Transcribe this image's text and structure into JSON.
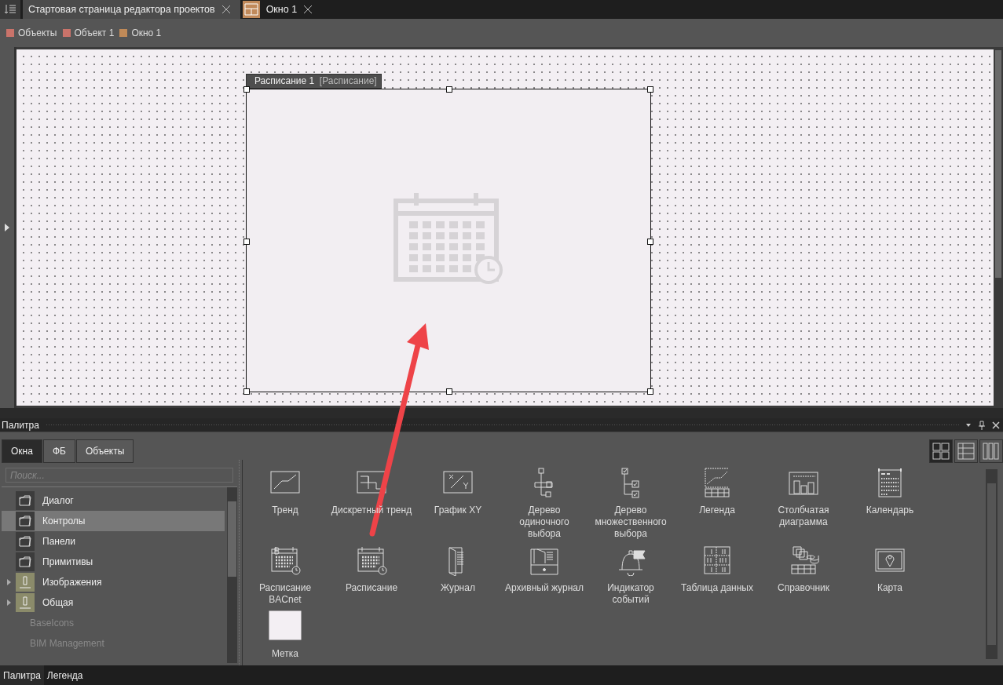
{
  "doc_tabs": [
    {
      "label": "Стартовая страница редактора проектов",
      "kind": "start",
      "selected": false
    },
    {
      "label": "Окно 1",
      "kind": "window",
      "selected": true
    }
  ],
  "breadcrumb": [
    {
      "label": "Объекты",
      "color": "#c9736a"
    },
    {
      "label": "Объект 1",
      "color": "#c9736a"
    },
    {
      "label": "Окно 1",
      "color": "#c08a58"
    }
  ],
  "canvas": {
    "widget": {
      "name": "Расписание 1",
      "type": "[Расписание]"
    }
  },
  "palette": {
    "title": "Палитра",
    "tabs": [
      {
        "label": "Окна",
        "selected": true
      },
      {
        "label": "ФБ",
        "selected": false
      },
      {
        "label": "Объекты",
        "selected": false
      }
    ],
    "search": {
      "placeholder": "Поиск..."
    },
    "tree": [
      {
        "label": "Диалог",
        "kind": "folder",
        "selected": false,
        "disabled": false
      },
      {
        "label": "Контролы",
        "kind": "folder",
        "selected": true,
        "disabled": false
      },
      {
        "label": "Панели",
        "kind": "folder",
        "selected": false,
        "disabled": false
      },
      {
        "label": "Примитивы",
        "kind": "folder",
        "selected": false,
        "disabled": false
      },
      {
        "label": "Изображения",
        "kind": "library",
        "selected": false,
        "disabled": false
      },
      {
        "label": "Общая",
        "kind": "library",
        "selected": false,
        "disabled": false
      },
      {
        "label": "BaseIcons",
        "kind": "text",
        "selected": false,
        "disabled": true
      },
      {
        "label": "BIM Management",
        "kind": "text",
        "selected": false,
        "disabled": true
      }
    ],
    "view_modes": [
      {
        "kind": "tiles",
        "selected": true
      },
      {
        "kind": "table",
        "selected": false
      },
      {
        "kind": "columns",
        "selected": false
      }
    ],
    "items": [
      {
        "label": "Тренд",
        "kind": "trend"
      },
      {
        "label": "Дискретный тренд",
        "kind": "discrete"
      },
      {
        "label": "График XY",
        "kind": "xy"
      },
      {
        "label": "Дерево одиночного выбора",
        "kind": "tree1"
      },
      {
        "label": "Дерево множественного выбора",
        "kind": "treem"
      },
      {
        "label": "Легенда",
        "kind": "legend"
      },
      {
        "label": "Столбчатая диаграмма",
        "kind": "bars"
      },
      {
        "label": "Календарь",
        "kind": "calendar"
      },
      {
        "label": "Расписание BACnet",
        "kind": "bacnet"
      },
      {
        "label": "Расписание",
        "kind": "schedule"
      },
      {
        "label": "Журнал",
        "kind": "journal"
      },
      {
        "label": "Архивный журнал",
        "kind": "archive"
      },
      {
        "label": "Индикатор событий",
        "kind": "bell"
      },
      {
        "label": "Таблица данных",
        "kind": "table"
      },
      {
        "label": "Справочник",
        "kind": "reference"
      },
      {
        "label": "Карта",
        "kind": "map"
      },
      {
        "label": "Метка",
        "kind": "label"
      }
    ]
  },
  "bottom_tabs": [
    {
      "label": "Палитра",
      "selected": true
    },
    {
      "label": "Легенда",
      "selected": false
    }
  ]
}
